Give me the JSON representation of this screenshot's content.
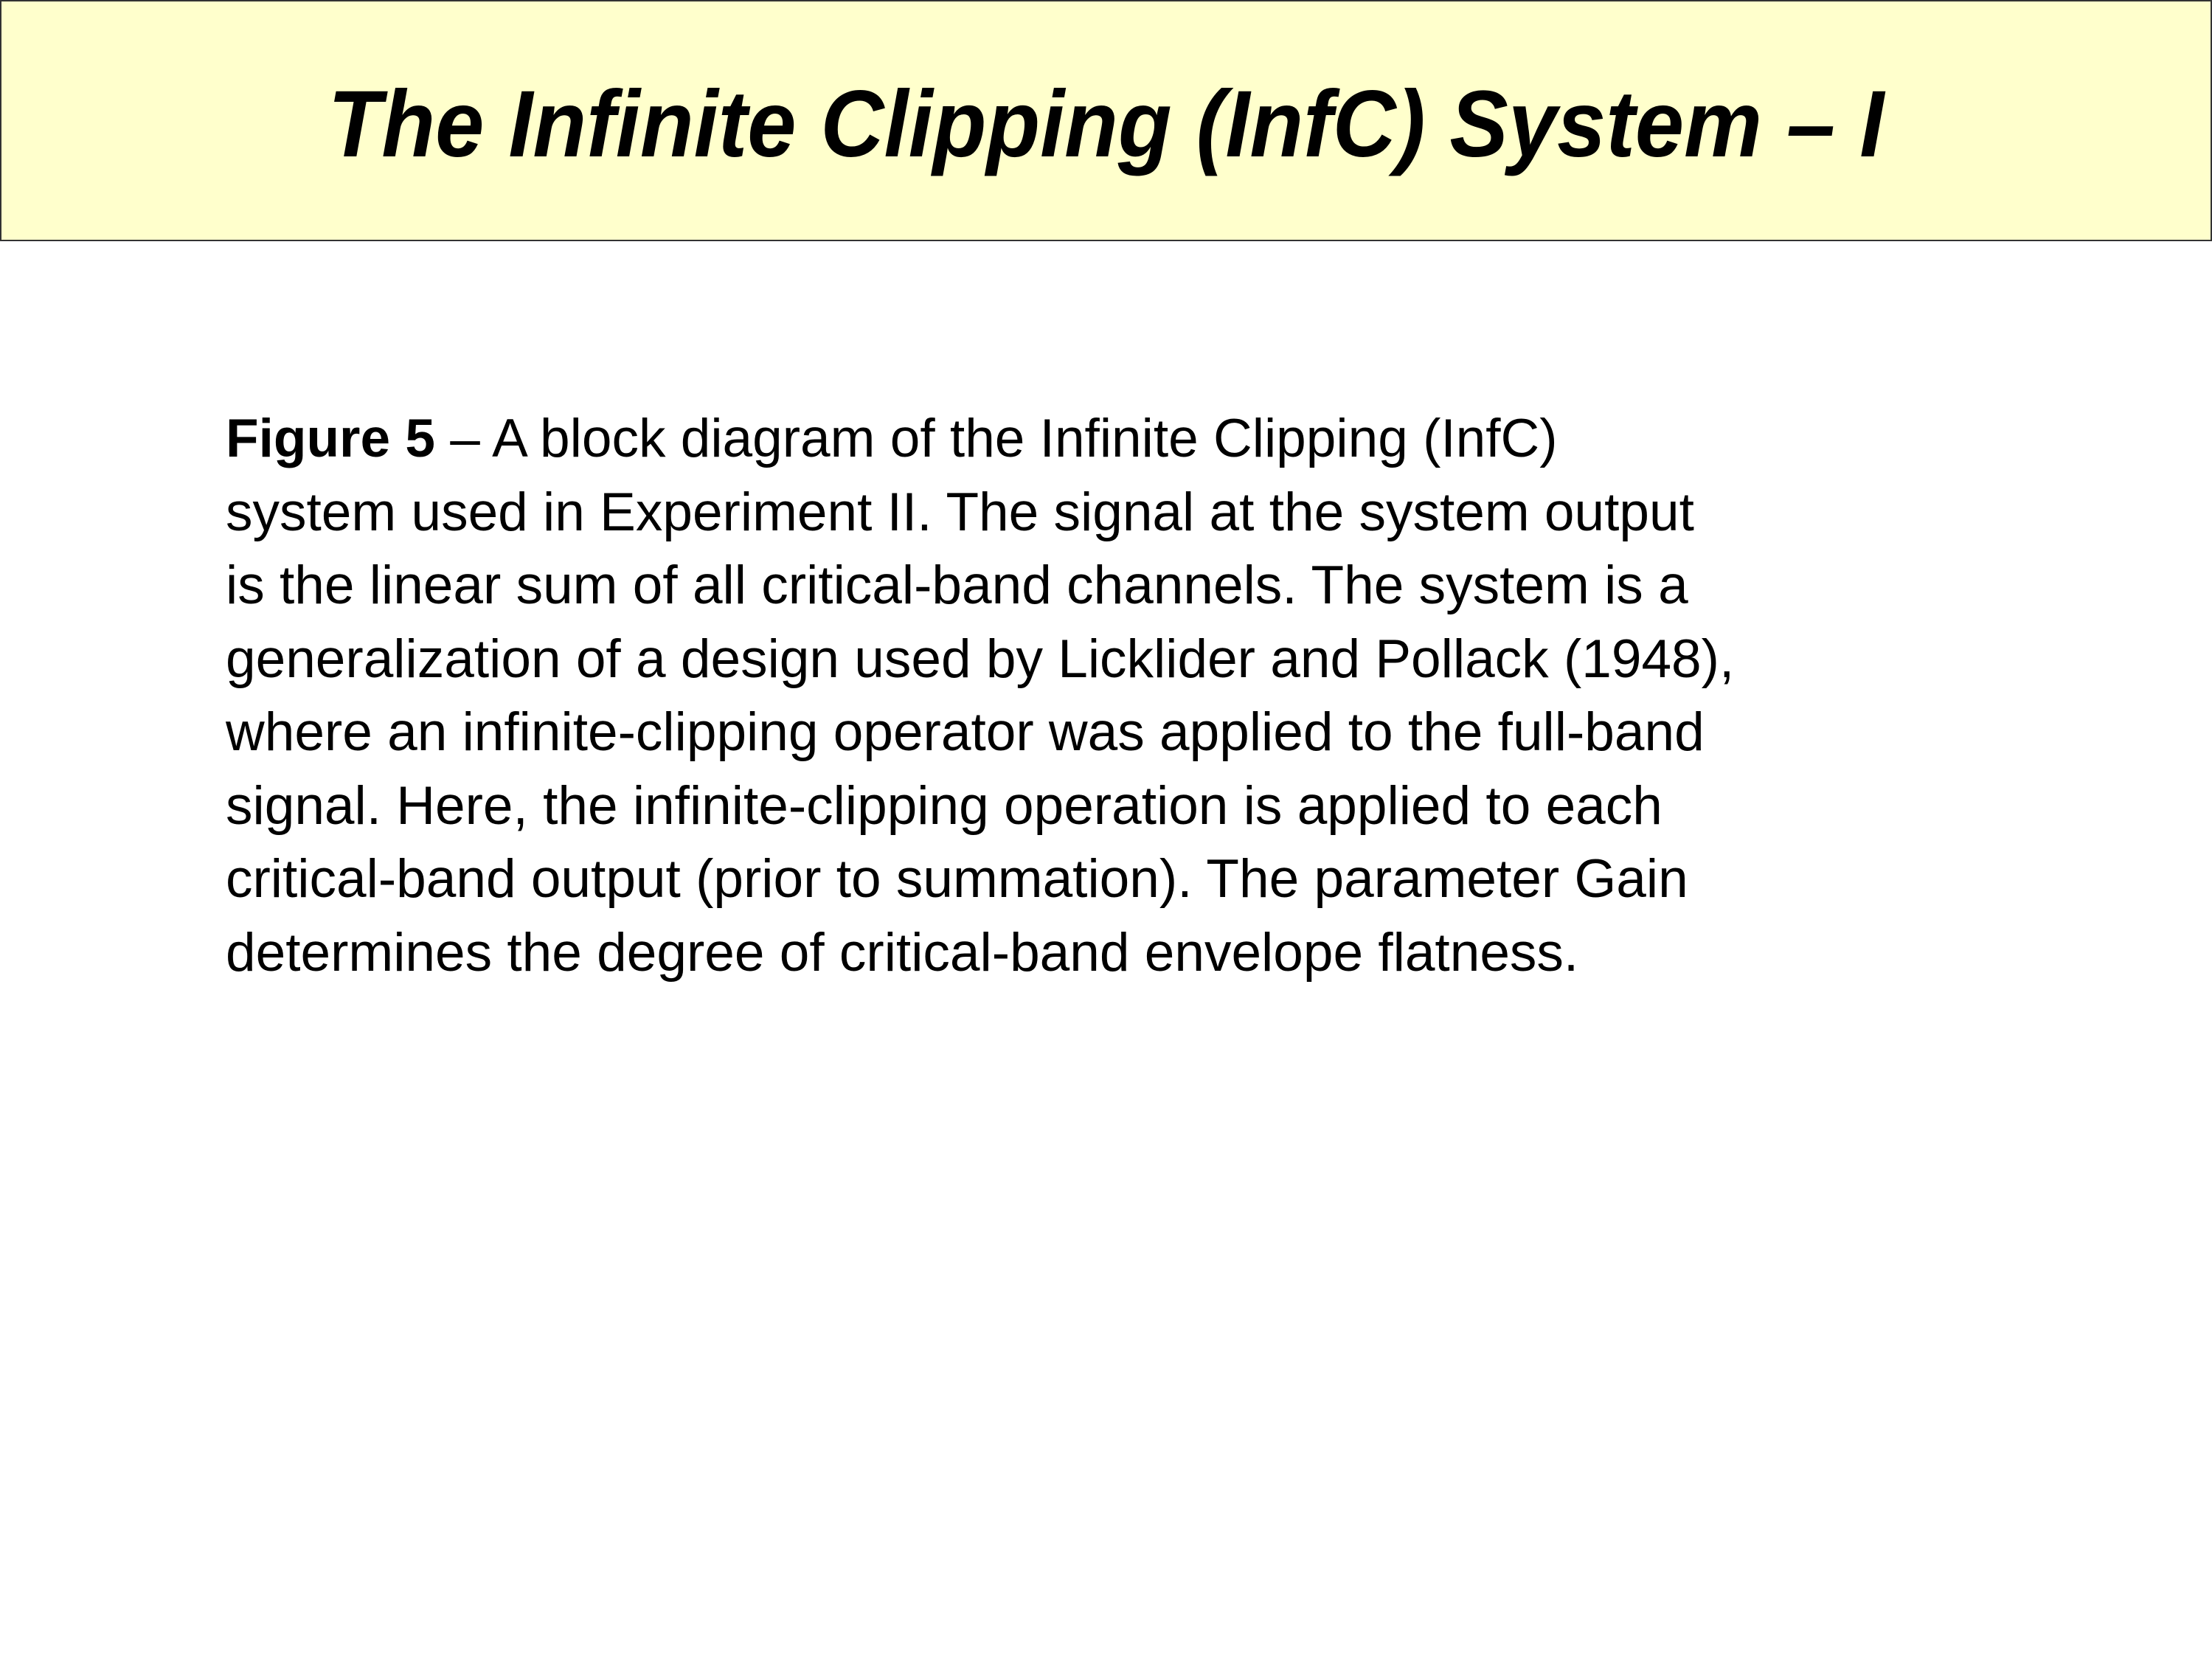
{
  "slide": {
    "title": "The Infinite Clipping (InfC) System – I",
    "header_bg": "#FFFFCC",
    "caption": {
      "label": "Figure 5",
      "lines": [
        " – A block diagram of the Infinite Clipping (InfC)",
        "system used in Experiment II. The signal at the system output",
        "is the linear sum of all critical-band channels. The system is a",
        "generalization of a design used by Licklider and Pollack (1948),",
        "where an infinite-clipping operator was applied to the full-band",
        "signal. Here, the infinite-clipping operation is applied to each",
        "critical-band output (prior to summation). The parameter Gain",
        "determines the degree of critical-band envelope flatness."
      ]
    }
  }
}
